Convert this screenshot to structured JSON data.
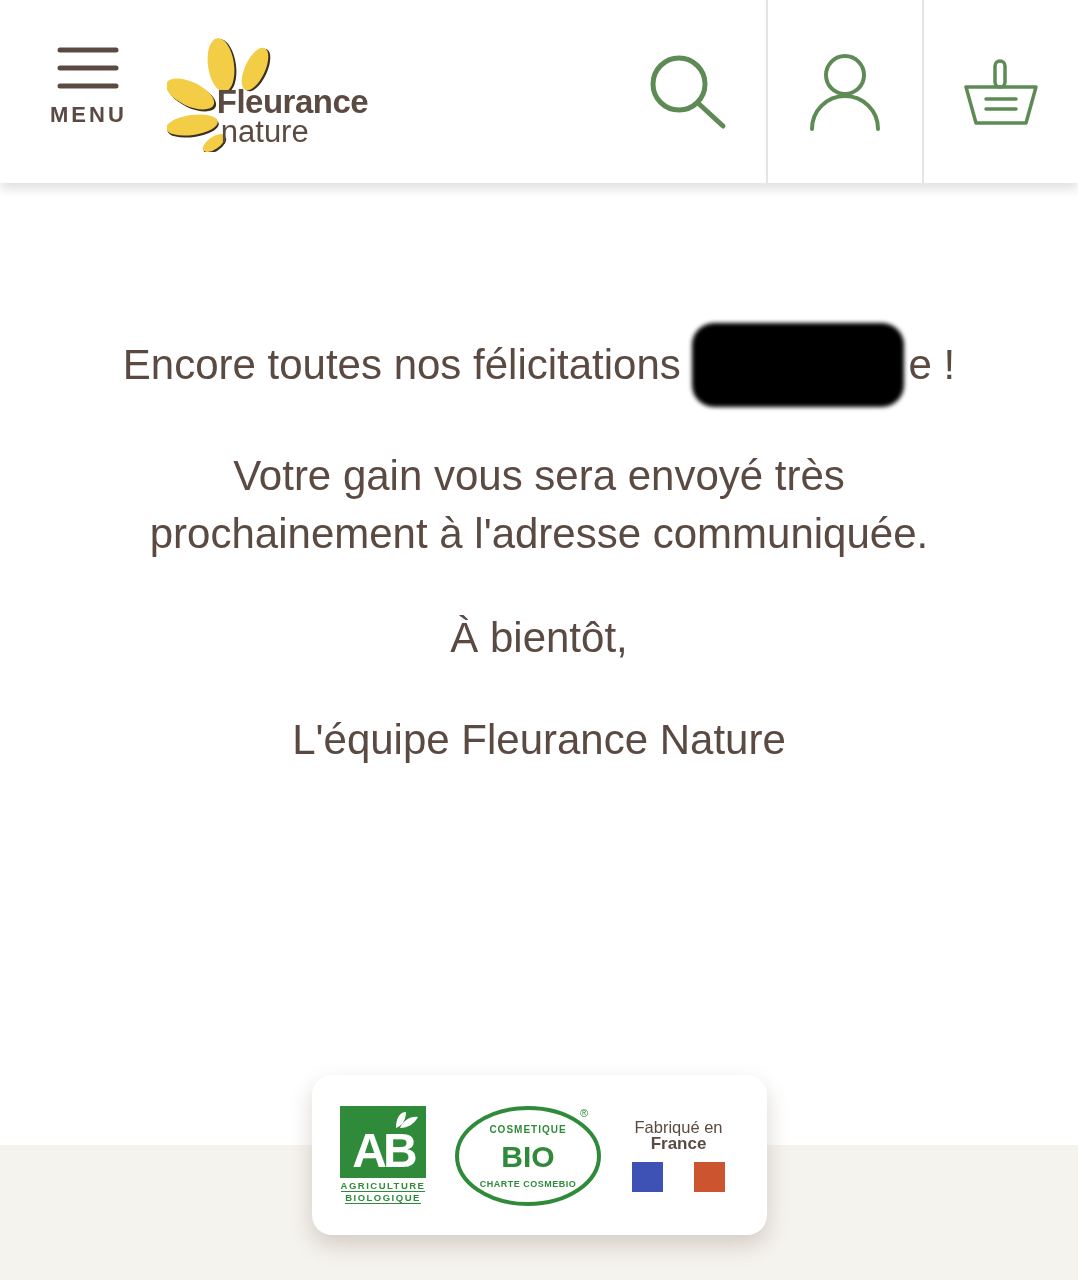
{
  "header": {
    "menu_label": "MENU",
    "logo": {
      "line_1": "Fleurance",
      "line_2": "nature"
    }
  },
  "message": {
    "greeting": {
      "before": "Encore toutes nos félicitations",
      "redacted": true,
      "after": "e !"
    },
    "paragraphs": [
      "Votre gain vous sera envoyé très prochainement à l'adresse communiquée.",
      "À bientôt,",
      "L'équipe Fleurance Nature"
    ]
  },
  "labels": {
    "ab": {
      "letters": "AB",
      "line_1": "AGRICULTURE",
      "line_2": "BIOLOGIQUE"
    },
    "cosmebio": {
      "top": "COSMETIQUE",
      "center": "BIO",
      "bottom": "CHARTE COSMEBIO",
      "mark": "®"
    },
    "origin": {
      "line_1": "Fabriqué en",
      "line_2": "France"
    }
  }
}
